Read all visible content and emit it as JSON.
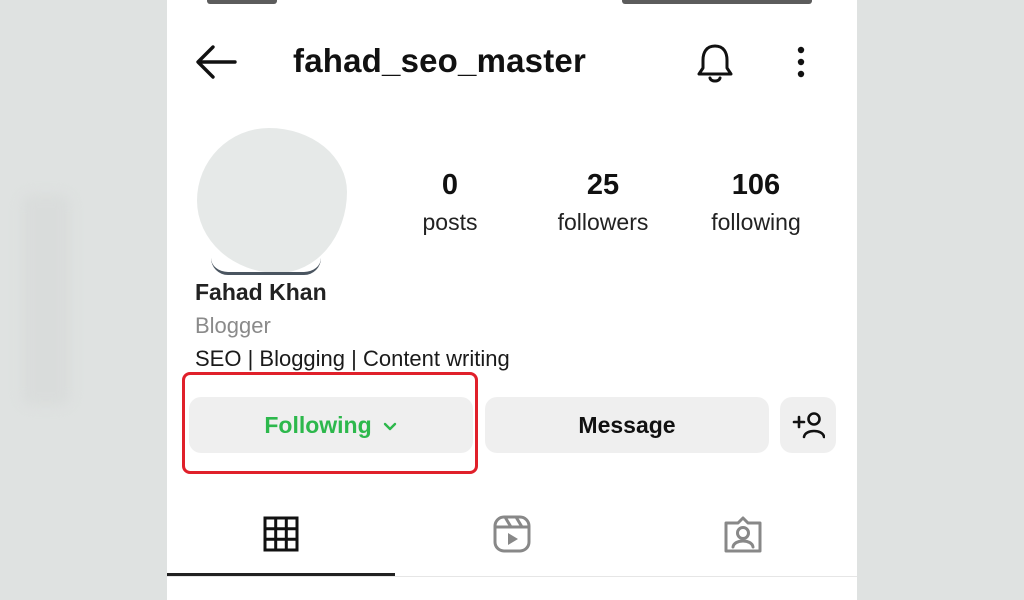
{
  "profile": {
    "username": "fahad_seo_master",
    "name": "Fahad Khan",
    "category": "Blogger",
    "bio": "SEO | Blogging | Content writing"
  },
  "stats": [
    {
      "count": "0",
      "label": "posts"
    },
    {
      "count": "25",
      "label": "followers"
    },
    {
      "count": "106",
      "label": "following"
    }
  ],
  "actions": {
    "following_label": "Following",
    "message_label": "Message"
  },
  "icons": {
    "back": "arrow-left-icon",
    "bell": "bell-icon",
    "more": "more-vertical-icon",
    "chevron": "chevron-down-icon",
    "add_user": "add-user-icon",
    "tabs": [
      "grid-icon",
      "reels-icon",
      "tagged-icon"
    ]
  },
  "colors": {
    "following_text": "#2db84c",
    "highlight_box": "#e0202a",
    "button_bg": "#efefef"
  }
}
